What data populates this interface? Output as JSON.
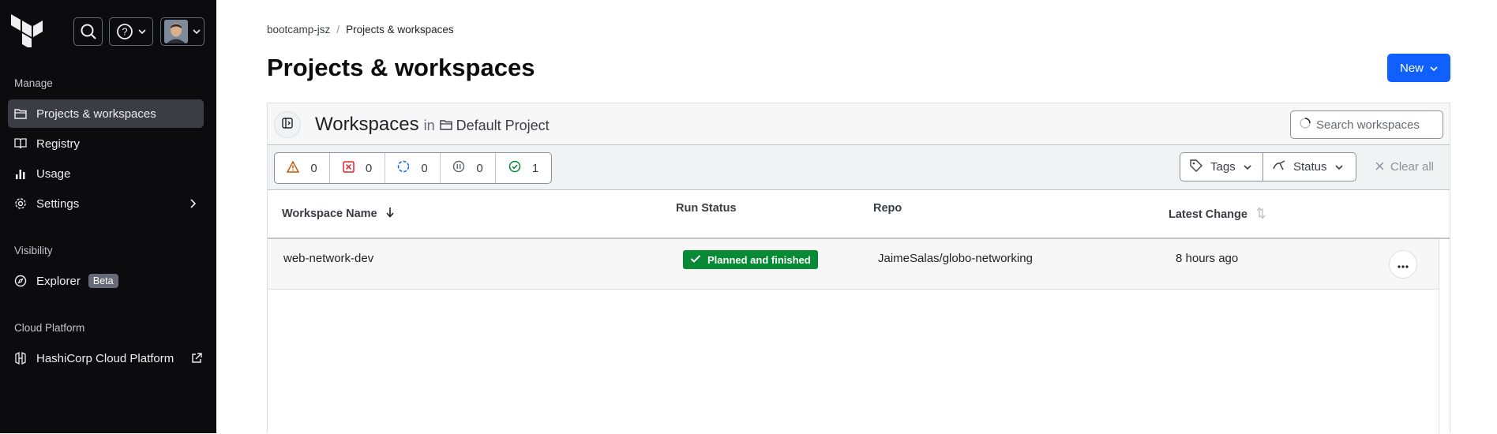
{
  "sidebar": {
    "sections": {
      "manage": "Manage",
      "visibility": "Visibility",
      "cloud_platform": "Cloud Platform"
    },
    "items": [
      {
        "label": "Projects & workspaces",
        "icon": "folder-icon"
      },
      {
        "label": "Registry",
        "icon": "registry-icon"
      },
      {
        "label": "Usage",
        "icon": "bar-chart-icon"
      },
      {
        "label": "Settings",
        "icon": "gear-icon"
      },
      {
        "label": "Explorer",
        "icon": "compass-icon",
        "badge": "Beta"
      },
      {
        "label": "HashiCorp Cloud Platform",
        "icon": "hcp-icon"
      }
    ]
  },
  "breadcrumb": {
    "org": "bootcamp-jsz",
    "separator": "/",
    "current": "Projects & workspaces"
  },
  "page": {
    "title": "Projects & workspaces",
    "new_label": "New"
  },
  "workspaces_header": {
    "title": "Workspaces",
    "in": "in",
    "project": "Default Project",
    "search_placeholder": "Search workspaces"
  },
  "status_counts": [
    {
      "icon": "warning-icon",
      "count": "0",
      "color": "#c25c0a"
    },
    {
      "icon": "error-icon",
      "count": "0",
      "color": "#e52228"
    },
    {
      "icon": "running-icon",
      "count": "0",
      "color": "#1060ff"
    },
    {
      "icon": "paused-icon",
      "count": "0",
      "color": "#656a76"
    },
    {
      "icon": "success-icon",
      "count": "1",
      "color": "#078a35"
    }
  ],
  "filters": {
    "tags": "Tags",
    "status": "Status",
    "clear": "Clear all"
  },
  "table": {
    "columns": {
      "name": "Workspace Name",
      "run_status": "Run Status",
      "repo": "Repo",
      "latest_change": "Latest Change"
    },
    "rows": [
      {
        "name": "web-network-dev",
        "run_status": "Planned and finished",
        "repo": "JaimeSalas/globo-networking",
        "latest_change": "8 hours ago"
      }
    ]
  },
  "colors": {
    "accent": "#1060ff",
    "sidebar_bg": "#0c0c0e",
    "success": "#078a35"
  }
}
